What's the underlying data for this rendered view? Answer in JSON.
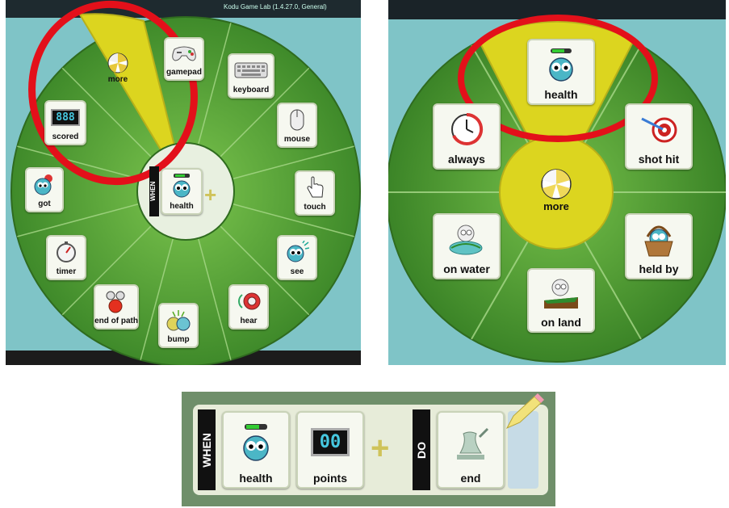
{
  "panel_left": {
    "title_bar": "Kodu Game Lab (1.4.27.0, General)",
    "pie_items": [
      {
        "key": "more",
        "label": "more",
        "icon": "pie-more-icon",
        "selected": true
      },
      {
        "key": "gamepad",
        "label": "gamepad",
        "icon": "gamepad-icon"
      },
      {
        "key": "keyboard",
        "label": "keyboard",
        "icon": "keyboard-icon"
      },
      {
        "key": "mouse",
        "label": "mouse",
        "icon": "mouse-icon"
      },
      {
        "key": "touch",
        "label": "touch",
        "icon": "hand-pointer-icon"
      },
      {
        "key": "see",
        "label": "see",
        "icon": "see-eye-icon"
      },
      {
        "key": "hear",
        "label": "hear",
        "icon": "speaker-icon"
      },
      {
        "key": "bump",
        "label": "bump",
        "icon": "bump-icon"
      },
      {
        "key": "end_of_path",
        "label": "end of path",
        "icon": "path-end-icon"
      },
      {
        "key": "timer",
        "label": "timer",
        "icon": "stopwatch-icon"
      },
      {
        "key": "got",
        "label": "got",
        "icon": "got-apple-icon"
      },
      {
        "key": "scored",
        "label": "scored",
        "icon": "score-digits-icon"
      }
    ],
    "center": {
      "when": "WHEN",
      "label": "health",
      "icon": "health-kodu-icon"
    },
    "score_digits": "888"
  },
  "panel_right": {
    "pie_items": [
      {
        "key": "health",
        "label": "health",
        "icon": "health-kodu-icon",
        "selected": true
      },
      {
        "key": "shot_hit",
        "label": "shot hit",
        "icon": "target-icon"
      },
      {
        "key": "held_by",
        "label": "held by",
        "icon": "basket-icon"
      },
      {
        "key": "on_land",
        "label": "on land",
        "icon": "land-icon"
      },
      {
        "key": "on_water",
        "label": "on water",
        "icon": "water-icon"
      },
      {
        "key": "always",
        "label": "always",
        "icon": "clock-icon"
      }
    ],
    "center": {
      "label": "more",
      "icon": "pie-more-icon"
    }
  },
  "panel_bottom": {
    "when": "WHEN",
    "do": "DO",
    "tiles": [
      {
        "key": "health",
        "label": "health",
        "icon": "health-kodu-icon"
      },
      {
        "key": "points",
        "label": "points",
        "icon": "score-digits-icon",
        "digits": "00"
      },
      {
        "key": "end",
        "label": "end",
        "icon": "chess-king-icon"
      }
    ]
  },
  "colors": {
    "ring_green": "#4f9a33",
    "ring_light": "#6db845",
    "highlight_yellow": "#d9d21f",
    "annotation_red": "#e3101a",
    "tile_bg": "#f6f8f0"
  }
}
